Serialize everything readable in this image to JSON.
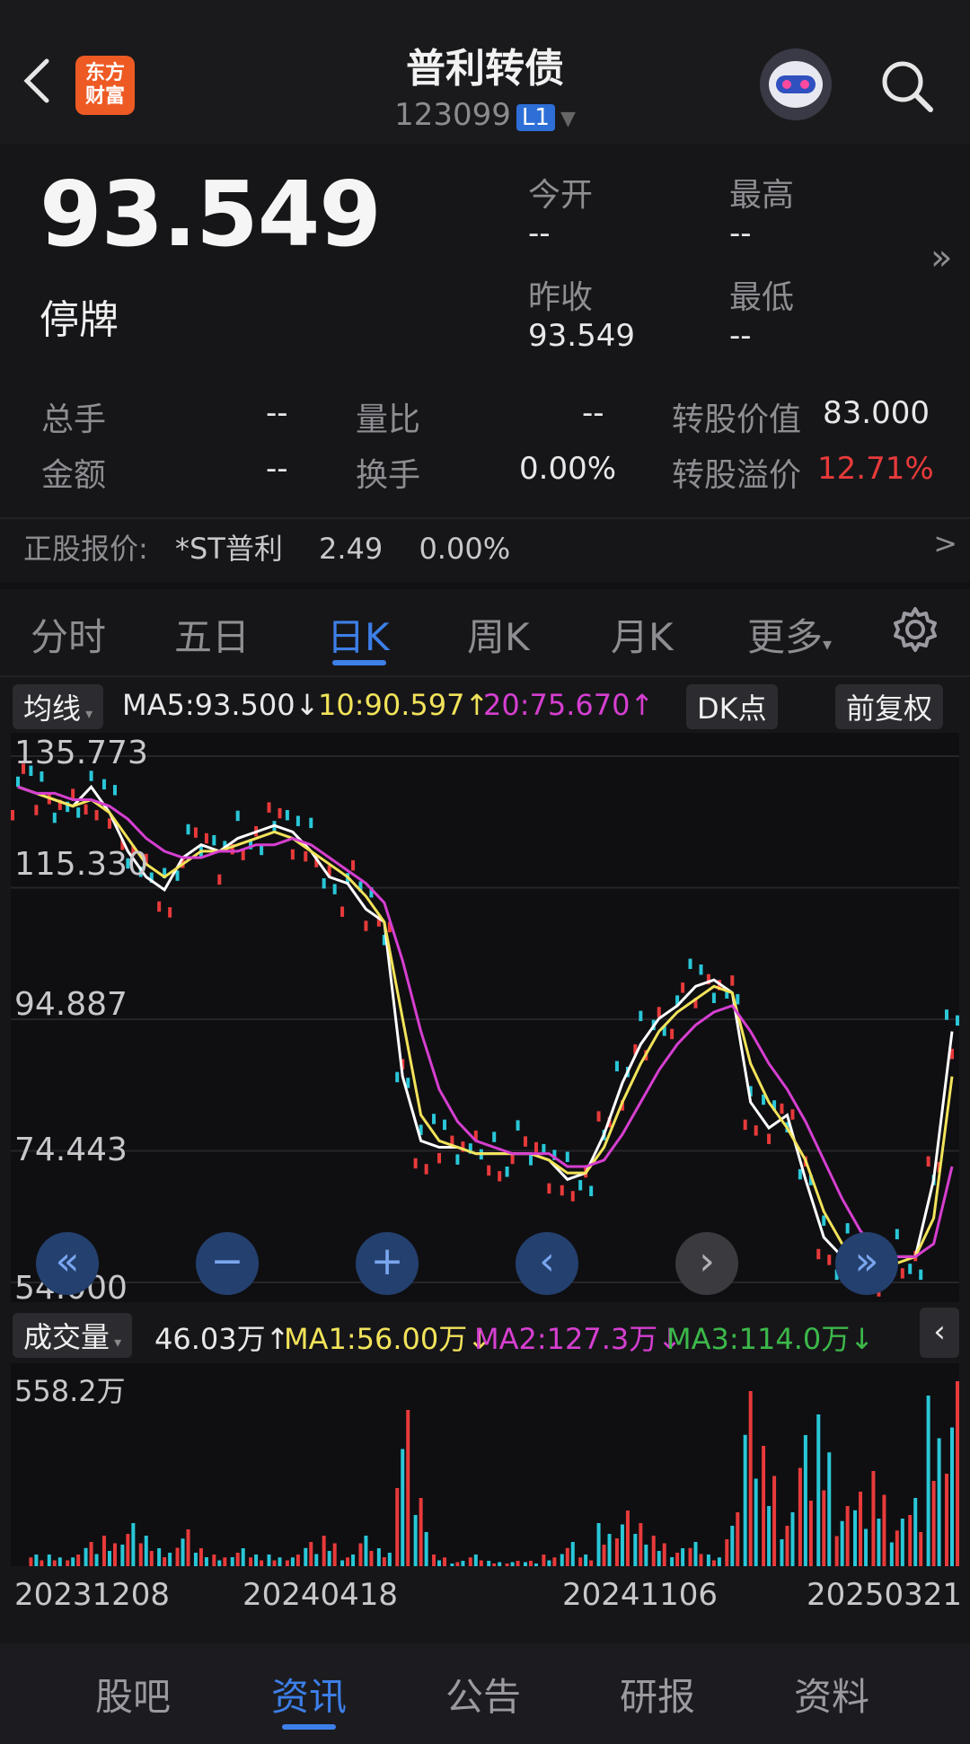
{
  "header": {
    "back_icon": "chevron-left",
    "logo_text": "东方\n财富",
    "title": "普利转债",
    "code": "123099",
    "level": "L1",
    "robot_icon": "robot-avatar",
    "search_icon": "search"
  },
  "quote": {
    "price": "93.549",
    "status": "停牌",
    "open_label": "今开",
    "open_value": "--",
    "high_label": "最高",
    "high_value": "--",
    "prev_close_label": "昨收",
    "prev_close_value": "93.549",
    "low_label": "最低",
    "low_value": "--",
    "more_icon": "double-chevron-right"
  },
  "stats": [
    {
      "label": "总手",
      "value": "--"
    },
    {
      "label": "量比",
      "value": "--"
    },
    {
      "label": "转股价值",
      "value": "83.000"
    },
    {
      "label": "金额",
      "value": "--"
    },
    {
      "label": "换手",
      "value": "0.00%"
    },
    {
      "label": "转股溢价",
      "value": "12.71%"
    }
  ],
  "stock": {
    "label": "正股报价:",
    "name": "*ST普利",
    "price": "2.49",
    "change": "0.00%",
    "arrow": ">"
  },
  "tabs": [
    "分时",
    "五日",
    "日K",
    "周K",
    "月K",
    "更多"
  ],
  "active_tab": "日K",
  "ma_bar": {
    "selector": "均线",
    "ma5": "MA5:93.500↓",
    "ma10": "10:90.597↑",
    "ma20": "20:75.670↑",
    "dk": "DK点",
    "adjust": "前复权"
  },
  "price_axis": [
    "135.773",
    "115.330",
    "94.887",
    "74.443",
    "54.000"
  ],
  "vol_bar": {
    "selector": "成交量",
    "vol": "46.03万↑",
    "ma1": "MA1:56.00万↓",
    "ma2": "MA2:127.3万↓",
    "ma3": "MA3:114.0万↓"
  },
  "vol_axis_top": "558.2万",
  "dates": [
    "20231208",
    "20240418",
    "20241106",
    "20250321"
  ],
  "bottom_tabs": [
    "股吧",
    "资讯",
    "公告",
    "研报",
    "资料"
  ],
  "active_bottom": "资讯",
  "colors": {
    "up": "#e83a3a",
    "down": "#29c7d8",
    "ma5": "#ffffff",
    "ma10": "#f2e35a",
    "ma20": "#d63fd0",
    "accent": "#3d7fe8"
  },
  "chart_data": {
    "type": "line",
    "title": "",
    "ylim": [
      54.0,
      135.773
    ],
    "x_ticks": [
      "20231208",
      "20240418",
      "20241106",
      "20250321"
    ],
    "series": [
      {
        "name": "MA5",
        "values": [
          131,
          130,
          129,
          128,
          131,
          127,
          121,
          117,
          115,
          120,
          122,
          121,
          123,
          124,
          125,
          124,
          121,
          117,
          116,
          112,
          110,
          86,
          76,
          75,
          75,
          74,
          74,
          74,
          74,
          73,
          70,
          71,
          77,
          85,
          91,
          95,
          97,
          100,
          101,
          99,
          82,
          78,
          80,
          70,
          61,
          58,
          57,
          57,
          58,
          58,
          70,
          93
        ]
      },
      {
        "name": "MA10",
        "values": [
          131,
          130,
          129,
          128,
          129,
          127,
          123,
          119,
          117,
          119,
          121,
          121,
          122,
          123,
          124,
          123,
          121,
          119,
          117,
          114,
          110,
          95,
          80,
          76,
          75,
          74,
          74,
          74,
          74,
          73,
          71,
          71,
          75,
          82,
          88,
          93,
          96,
          98,
          100,
          99,
          88,
          82,
          78,
          73,
          65,
          60,
          58,
          57,
          57,
          58,
          64,
          86
        ]
      },
      {
        "name": "MA20",
        "values": [
          131,
          130,
          130,
          129,
          129,
          128,
          126,
          123,
          121,
          120,
          120,
          121,
          121,
          122,
          122,
          123,
          122,
          120,
          118,
          116,
          113,
          104,
          93,
          84,
          79,
          76,
          75,
          74,
          74,
          74,
          72,
          72,
          73,
          77,
          82,
          87,
          91,
          94,
          96,
          97,
          93,
          88,
          84,
          79,
          73,
          67,
          62,
          59,
          58,
          58,
          60,
          72
        ]
      }
    ],
    "volume": {
      "max_label": "558.2万",
      "unit": "万"
    }
  }
}
